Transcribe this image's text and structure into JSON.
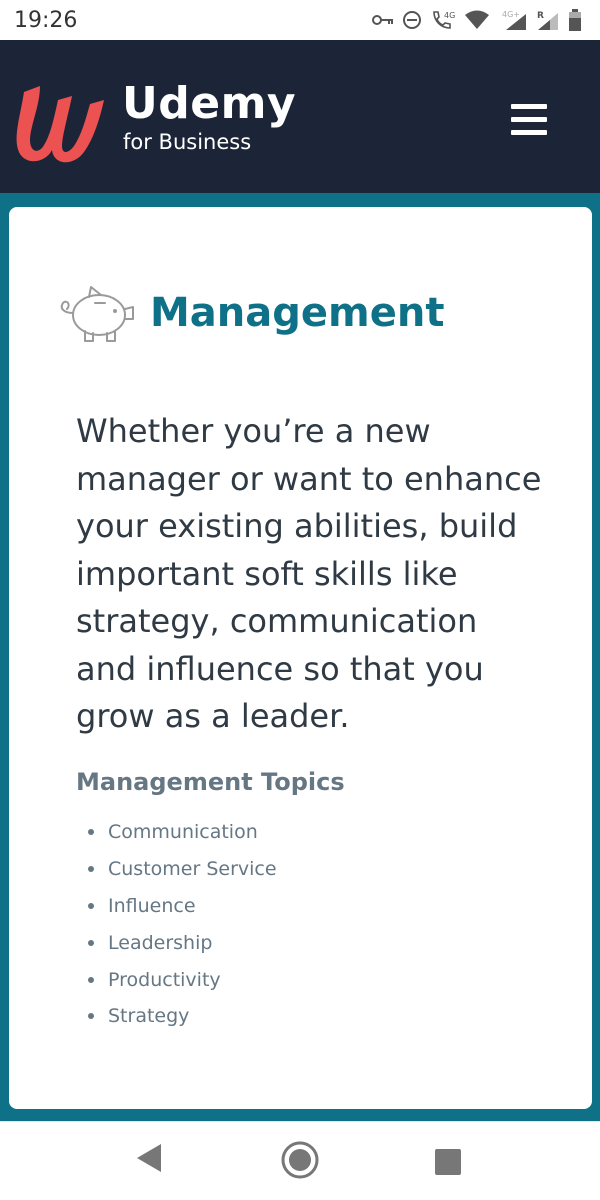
{
  "status_bar": {
    "time": "19:26",
    "icons": [
      "key-icon",
      "do-not-disturb-icon",
      "volte-call-icon",
      "wifi-icon",
      "signal-4g-icon",
      "signal-roaming-icon",
      "battery-icon"
    ],
    "network_label": "4G",
    "network_label2": "4G+",
    "roaming_label": "R"
  },
  "header": {
    "logo_text": "Udemy",
    "logo_subtext": "for Business",
    "brand_color": "#ec5252",
    "background_color": "#1c2537",
    "menu_icon": "hamburger-menu-icon"
  },
  "card": {
    "icon": "piggy-bank-icon",
    "title": "Management",
    "description": "Whether you’re a new manager or want to enhance your existing abilities, build important soft skills like strategy, communication and influence so that you grow as a leader.",
    "topics_heading": "Management Topics",
    "topics": [
      {
        "label": "Communication"
      },
      {
        "label": "Customer Service"
      },
      {
        "label": "Influence"
      },
      {
        "label": "Leadership"
      },
      {
        "label": "Productivity"
      },
      {
        "label": "Strategy"
      }
    ],
    "accent_color": "#0e7187"
  },
  "nav_bar": {
    "buttons": [
      "back-icon",
      "home-icon",
      "recents-icon"
    ]
  }
}
